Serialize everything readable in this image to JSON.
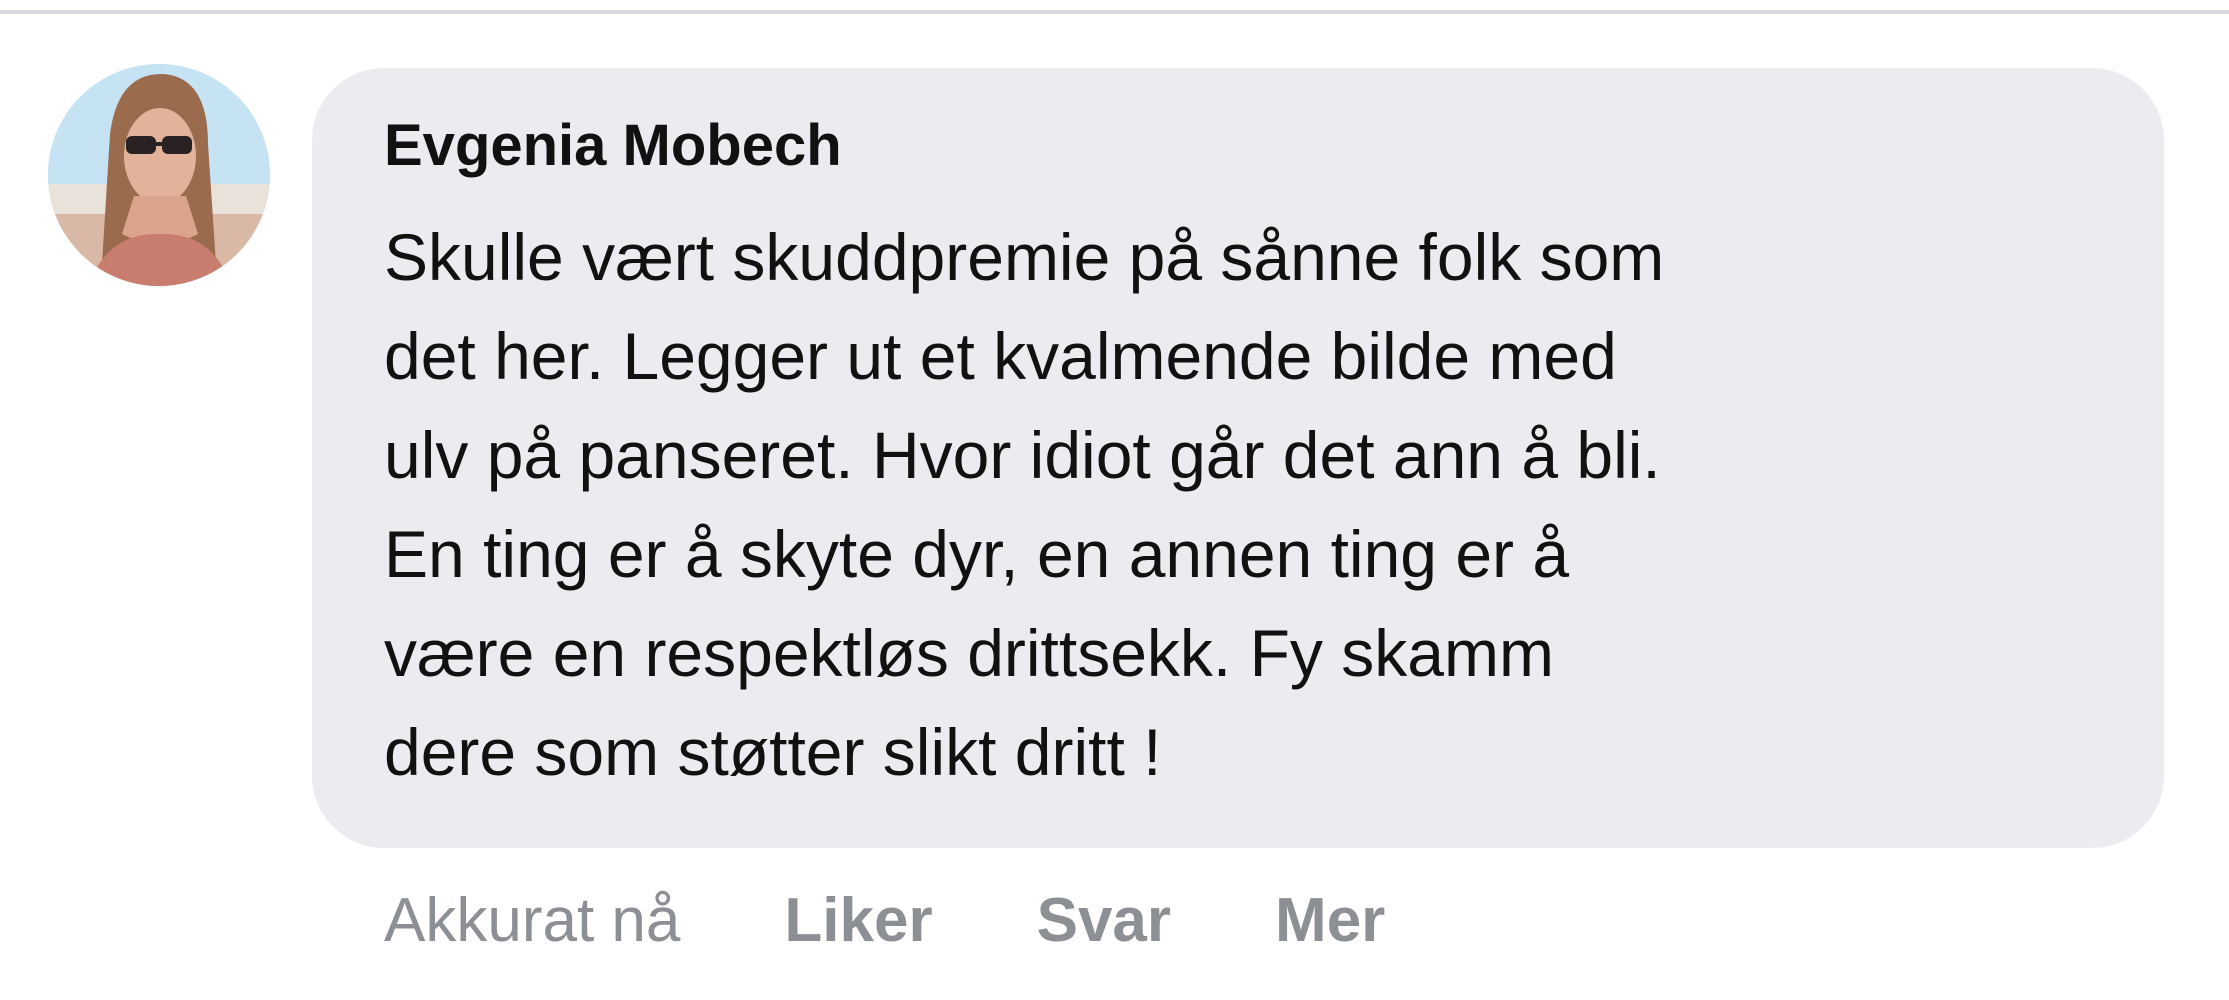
{
  "comment": {
    "author": "Evgenia Mobech",
    "text_lines": [
      "Skulle vært skuddpremie på sånne folk som",
      "det her. Legger ut et kvalmende bilde med",
      "ulv på panseret. Hvor idiot går det ann å bli.",
      "En ting er å skyte dyr, en annen ting er å",
      "være en respektløs drittsekk. Fy skamm",
      "dere som støtter slikt dritt !"
    ],
    "timestamp": "Akkurat nå",
    "actions": {
      "like": "Liker",
      "reply": "Svar",
      "more": "Mer"
    },
    "avatar_icon": "user-avatar-photo"
  },
  "colors": {
    "bubble_background": "#ececf0",
    "text": "#111111",
    "action_text": "#8c8f94",
    "divider": "#d7d9dc"
  }
}
